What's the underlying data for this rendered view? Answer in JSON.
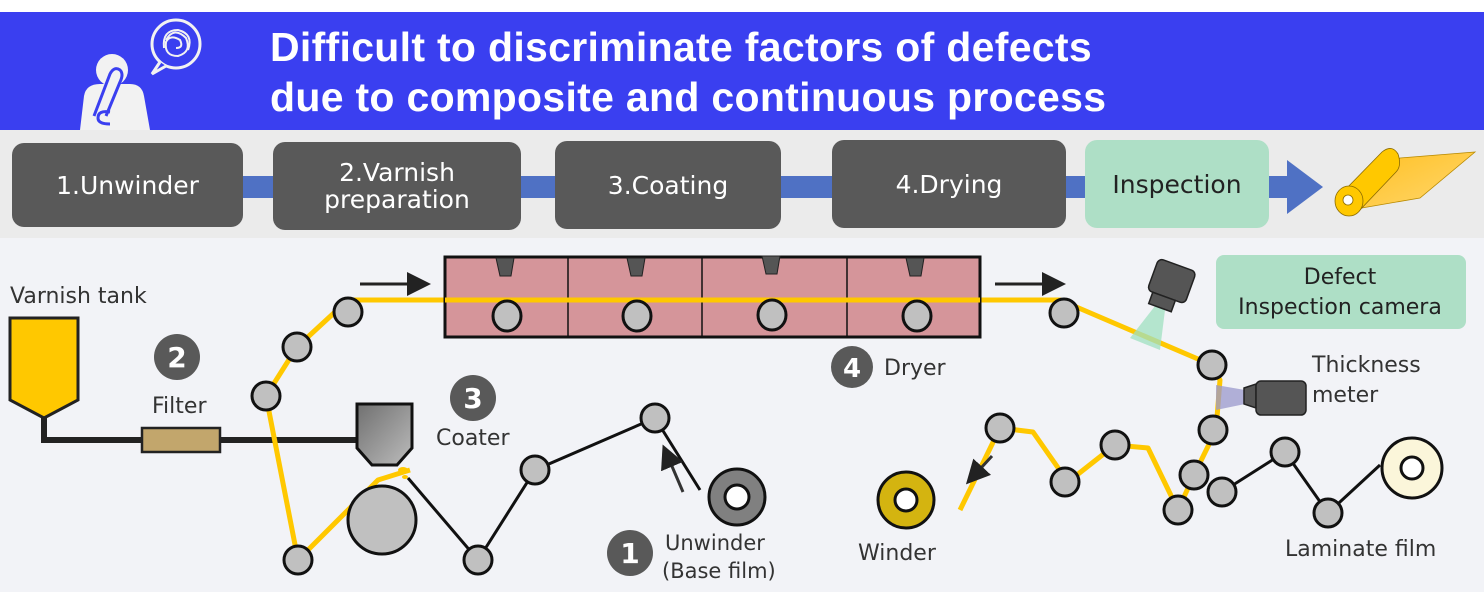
{
  "header": {
    "title_line1": "Difficult to discriminate factors of defects",
    "title_line2": "due to composite and continuous process",
    "icon": "confused-person-icon",
    "banner_color": "#3a3ff0"
  },
  "process_steps": [
    {
      "label": "1.Unwinder"
    },
    {
      "label_line1": "2.Varnish",
      "label_line2": "preparation"
    },
    {
      "label": "3.Coating"
    },
    {
      "label": "4.Drying"
    },
    {
      "label": "Inspection"
    }
  ],
  "process_end_icon": "film-roll-icon",
  "colors": {
    "step_box": "#595959",
    "inspection_box": "#aedfc6",
    "flow_arrow": "#4f71c4",
    "film_yellow": "#ffc800",
    "dryer": "#d5959a",
    "roller": "#c0c0c0"
  },
  "diagram": {
    "varnish_tank": "Varnish tank",
    "filter": {
      "number": "2",
      "label": "Filter"
    },
    "coater": {
      "number": "3",
      "label": "Coater"
    },
    "dryer": {
      "number": "4",
      "label": "Dryer"
    },
    "unwinder": {
      "number": "1",
      "label_line1": "Unwinder",
      "label_line2": "(Base film)"
    },
    "inspection_camera": {
      "line1": "Defect",
      "line2": "Inspection camera"
    },
    "thickness_meter": {
      "line1": "Thickness",
      "line2": "meter"
    },
    "winder": "Winder",
    "laminate_film": "Laminate film"
  }
}
